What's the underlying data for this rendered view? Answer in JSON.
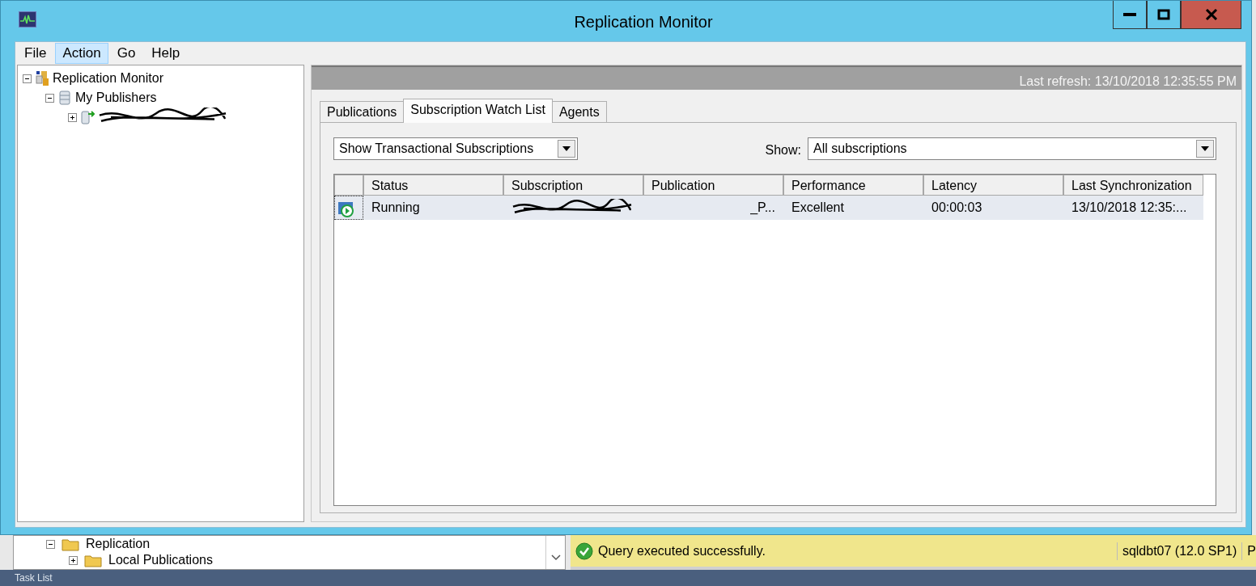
{
  "window": {
    "title": "Replication Monitor"
  },
  "menu": [
    {
      "label": "File",
      "selected": false
    },
    {
      "label": "Action",
      "selected": true
    },
    {
      "label": "Go",
      "selected": false
    },
    {
      "label": "Help",
      "selected": false
    }
  ],
  "tree": [
    {
      "label": "Replication Monitor",
      "kind": "monitor",
      "expanded": true,
      "children": [
        {
          "label": "My Publishers",
          "kind": "publishers",
          "expanded": true,
          "children": [
            {
              "kind": "publisher",
              "expanded": false,
              "redacted": true
            }
          ]
        }
      ]
    }
  ],
  "last_refresh": "Last refresh: 13/10/2018 12:35:55 PM",
  "tabs": [
    {
      "label": "Publications",
      "selected": false
    },
    {
      "label": "Subscription Watch List",
      "selected": true
    },
    {
      "label": "Agents",
      "selected": false
    }
  ],
  "type_filter": {
    "value": "Show Transactional Subscriptions"
  },
  "show_filter": {
    "label": "Show:",
    "value": "All subscriptions"
  },
  "table": {
    "columns": [
      "Status",
      "Subscription",
      "Publication",
      "Performance",
      "Latency",
      "Last Synchronization"
    ],
    "rows": [
      {
        "selected": true,
        "status": "Running",
        "publication": "_P...",
        "performance": "Excellent",
        "latency": "00:00:03",
        "last_synchronization": "13/10/2018 12:35:..."
      }
    ]
  },
  "background": {
    "tree": [
      {
        "label": "Replication",
        "expanded": true
      },
      {
        "label": "Local Publications",
        "expanded": false
      }
    ],
    "status": "Query executed successfully.",
    "server": "sqldbt07 (12.0 SP1)",
    "status_cut": "P",
    "panel": "Task List"
  }
}
